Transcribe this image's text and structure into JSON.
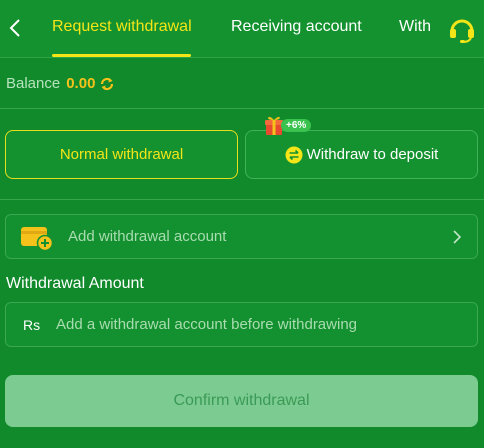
{
  "header": {
    "tabs": [
      {
        "label": "Request withdrawal",
        "active": true
      },
      {
        "label": "Receiving account",
        "active": false
      },
      {
        "label": "With",
        "active": false
      }
    ],
    "back_icon": "chevron-left-icon",
    "support_icon": "headset-icon"
  },
  "balance": {
    "label": "Balance",
    "value": "0.00",
    "refresh_icon": "refresh-icon"
  },
  "methods": {
    "normal": {
      "label": "Normal withdrawal",
      "selected": true
    },
    "deposit": {
      "label": "Withdraw to deposit",
      "bonus": "+6%",
      "gift_icon": "gift-icon",
      "swap_icon": "swap-icon"
    }
  },
  "account": {
    "add_label": "Add withdrawal account",
    "wallet_icon": "wallet-add-icon",
    "chevron_icon": "chevron-right-icon"
  },
  "amount": {
    "title": "Withdrawal Amount",
    "currency": "Rs",
    "placeholder": "Add a withdrawal account before withdrawing",
    "value": ""
  },
  "confirm": {
    "label": "Confirm withdrawal"
  },
  "colors": {
    "background": "#118a2c",
    "accent": "#f4e518",
    "balance_value": "#f4c21a",
    "confirm_bg": "#7ccc92"
  }
}
